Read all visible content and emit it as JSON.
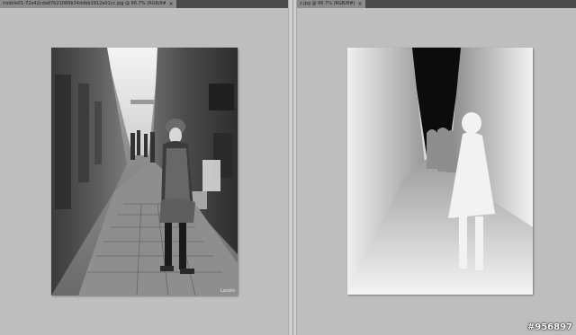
{
  "left_document": {
    "tab_title": "mobile01-72a42cda87b21089b34ddbb1912a01cc.jpg @ 66.7% (RGB/8#)",
    "close_symbol": "×",
    "image_signature": "Lazsto"
  },
  "right_document": {
    "tab_title": "z.jpg @ 66.7% (RGB/8#)",
    "close_symbol": "×"
  },
  "watermark": "#956897",
  "colors": {
    "workspace": "#bebebe",
    "tab_bar": "#4a4a4a",
    "active_tab": "#8c8c8c",
    "splitter": "#cfcfcf"
  }
}
